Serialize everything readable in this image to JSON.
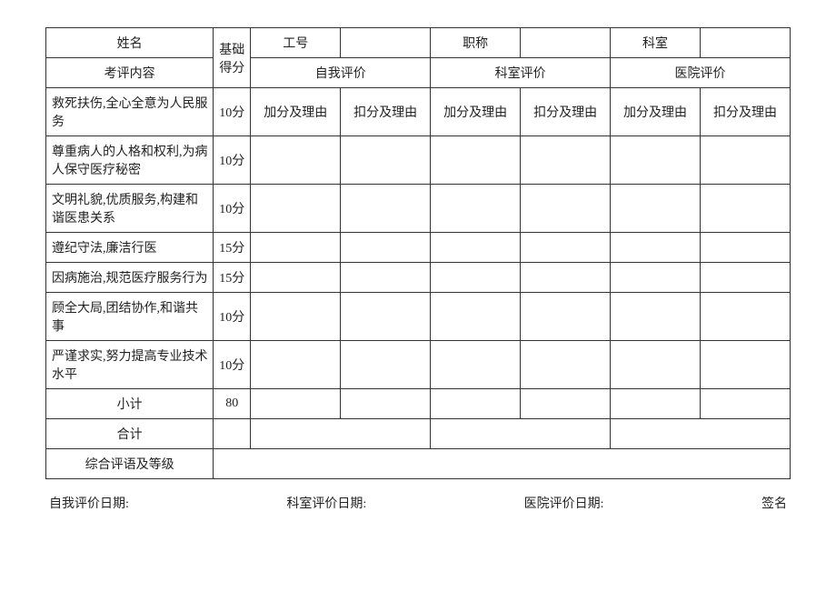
{
  "header": {
    "name_label": "姓名",
    "base_score_label": "基础得分",
    "emp_id_label": "工号",
    "title_label": "职称",
    "dept_label": "科室"
  },
  "row2": {
    "content_label": "考评内容",
    "self_eval_label": "自我评价",
    "dept_eval_label": "科室评价",
    "hosp_eval_label": "医院评价"
  },
  "subheaders": {
    "add_reason": "加分及理由",
    "sub_reason": "扣分及理由"
  },
  "items": [
    {
      "label": "救死扶伤,全心全意为人民服务",
      "score": "10分"
    },
    {
      "label": "尊重病人的人格和权利,为病人保守医疗秘密",
      "score": "10分"
    },
    {
      "label": "文明礼貌,优质服务,构建和谐医患关系",
      "score": "10分"
    },
    {
      "label": "遵纪守法,廉洁行医",
      "score": "15分"
    },
    {
      "label": "因病施治,规范医疗服务行为",
      "score": "15分"
    },
    {
      "label": "顾全大局,团结协作,和谐共事",
      "score": "10分"
    },
    {
      "label": "严谨求实,努力提高专业技术水平",
      "score": "10分"
    }
  ],
  "summary": {
    "subtotal_label": "小计",
    "subtotal_score": "80",
    "total_label": "合计",
    "overall_label": "综合评语及等级"
  },
  "footer": {
    "self_date": "自我评价日期:",
    "dept_date": "科室评价日期:",
    "hosp_date": "医院评价日期:",
    "sign": "签名"
  }
}
